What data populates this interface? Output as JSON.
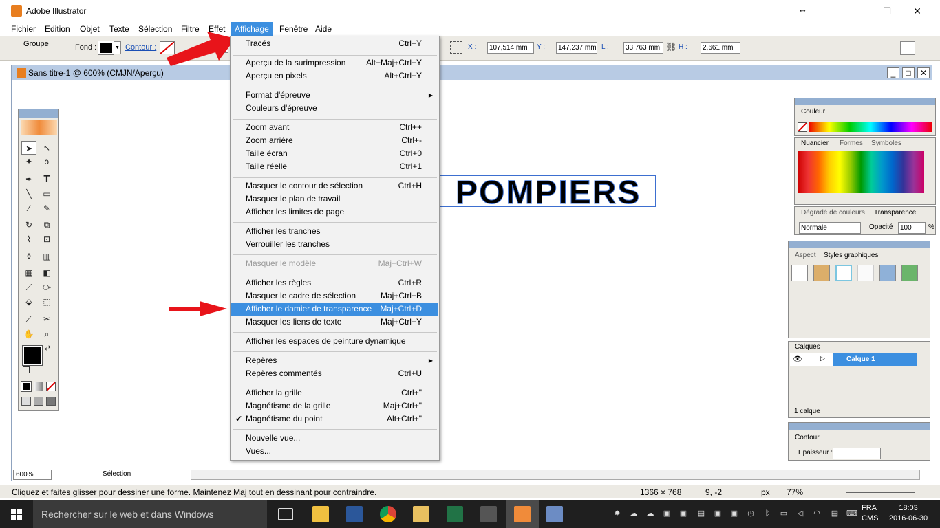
{
  "window": {
    "title": "Adobe Illustrator"
  },
  "menubar": [
    "Fichier",
    "Edition",
    "Objet",
    "Texte",
    "Sélection",
    "Filtre",
    "Effet",
    "Affichage",
    "Fenêtre",
    "Aide"
  ],
  "controlbar": {
    "selection_label": "Groupe",
    "fill_label": "Fond :",
    "stroke_label": "Contour :",
    "x_label": "X :",
    "x_value": "107,514 mm",
    "y_label": "Y :",
    "y_value": "147,237 mm",
    "w_label": "L :",
    "w_value": "33,763 mm",
    "h_label": "H :",
    "h_value": "2,661 mm"
  },
  "document": {
    "title": "Sans titre-1 @ 600% (CMJN/Aperçu)",
    "canvas_text": "POMPIERS",
    "zoom": "600%",
    "status_mode": "Sélection"
  },
  "menu": {
    "items": [
      {
        "label": "Tracés",
        "shortcut": "Ctrl+Y"
      },
      {
        "label": "Aperçu de la surimpression",
        "shortcut": "Alt+Maj+Ctrl+Y"
      },
      {
        "label": "Aperçu en pixels",
        "shortcut": "Alt+Ctrl+Y"
      },
      {
        "label": "Format d'épreuve",
        "shortcut": ""
      },
      {
        "label": "Couleurs d'épreuve",
        "shortcut": ""
      },
      {
        "label": "Zoom avant",
        "shortcut": "Ctrl++"
      },
      {
        "label": "Zoom arrière",
        "shortcut": "Ctrl+-"
      },
      {
        "label": "Taille écran",
        "shortcut": "Ctrl+0"
      },
      {
        "label": "Taille réelle",
        "shortcut": "Ctrl+1"
      },
      {
        "label": "Masquer le contour de sélection",
        "shortcut": "Ctrl+H"
      },
      {
        "label": "Masquer le plan de travail",
        "shortcut": ""
      },
      {
        "label": "Afficher les limites de page",
        "shortcut": ""
      },
      {
        "label": "Afficher les tranches",
        "shortcut": ""
      },
      {
        "label": "Verrouiller les tranches",
        "shortcut": ""
      },
      {
        "label": "Masquer le modèle",
        "shortcut": "Maj+Ctrl+W"
      },
      {
        "label": "Afficher les règles",
        "shortcut": "Ctrl+R"
      },
      {
        "label": "Masquer le cadre de sélection",
        "shortcut": "Maj+Ctrl+B"
      },
      {
        "label": "Afficher le damier de transparence",
        "shortcut": "Maj+Ctrl+D"
      },
      {
        "label": "Masquer les liens de texte",
        "shortcut": "Maj+Ctrl+Y"
      },
      {
        "label": "Afficher les espaces de peinture dynamique",
        "shortcut": ""
      },
      {
        "label": "Repères",
        "shortcut": ""
      },
      {
        "label": "Repères commentés",
        "shortcut": "Ctrl+U"
      },
      {
        "label": "Afficher la grille",
        "shortcut": "Ctrl+\""
      },
      {
        "label": "Magnétisme de la grille",
        "shortcut": "Maj+Ctrl+\""
      },
      {
        "label": "Magnétisme du point",
        "shortcut": "Alt+Ctrl+\""
      },
      {
        "label": "Nouvelle vue...",
        "shortcut": ""
      },
      {
        "label": "Vues...",
        "shortcut": ""
      }
    ]
  },
  "panels": {
    "couleur": "Couleur",
    "nuancier": "Nuancier",
    "formes": "Formes",
    "symboles": "Symboles",
    "degrade": "Dégradé de couleurs",
    "transparence": "Transparence",
    "blend_mode": "Normale",
    "opacite_label": "Opacité",
    "opacite_value": "100",
    "percent": "%",
    "aspect": "Aspect",
    "styles": "Styles graphiques",
    "calques": "Calques",
    "calque1": "Calque 1",
    "calque_count": "1 calque",
    "contour": "Contour",
    "epaisseur": "Epaisseur :"
  },
  "statusbar": {
    "hint": "Cliquez et faites glisser pour dessiner une forme. Maintenez Maj tout en dessinant pour contraindre.",
    "dims": "1366 × 768",
    "coords": "9, -2",
    "unit": "px",
    "zoom": "77%"
  },
  "taskbar": {
    "search": "Rechercher sur le web et dans Windows",
    "lang1": "FRA",
    "lang2": "CMS",
    "time": "18:03",
    "date": "2016-06-30"
  }
}
